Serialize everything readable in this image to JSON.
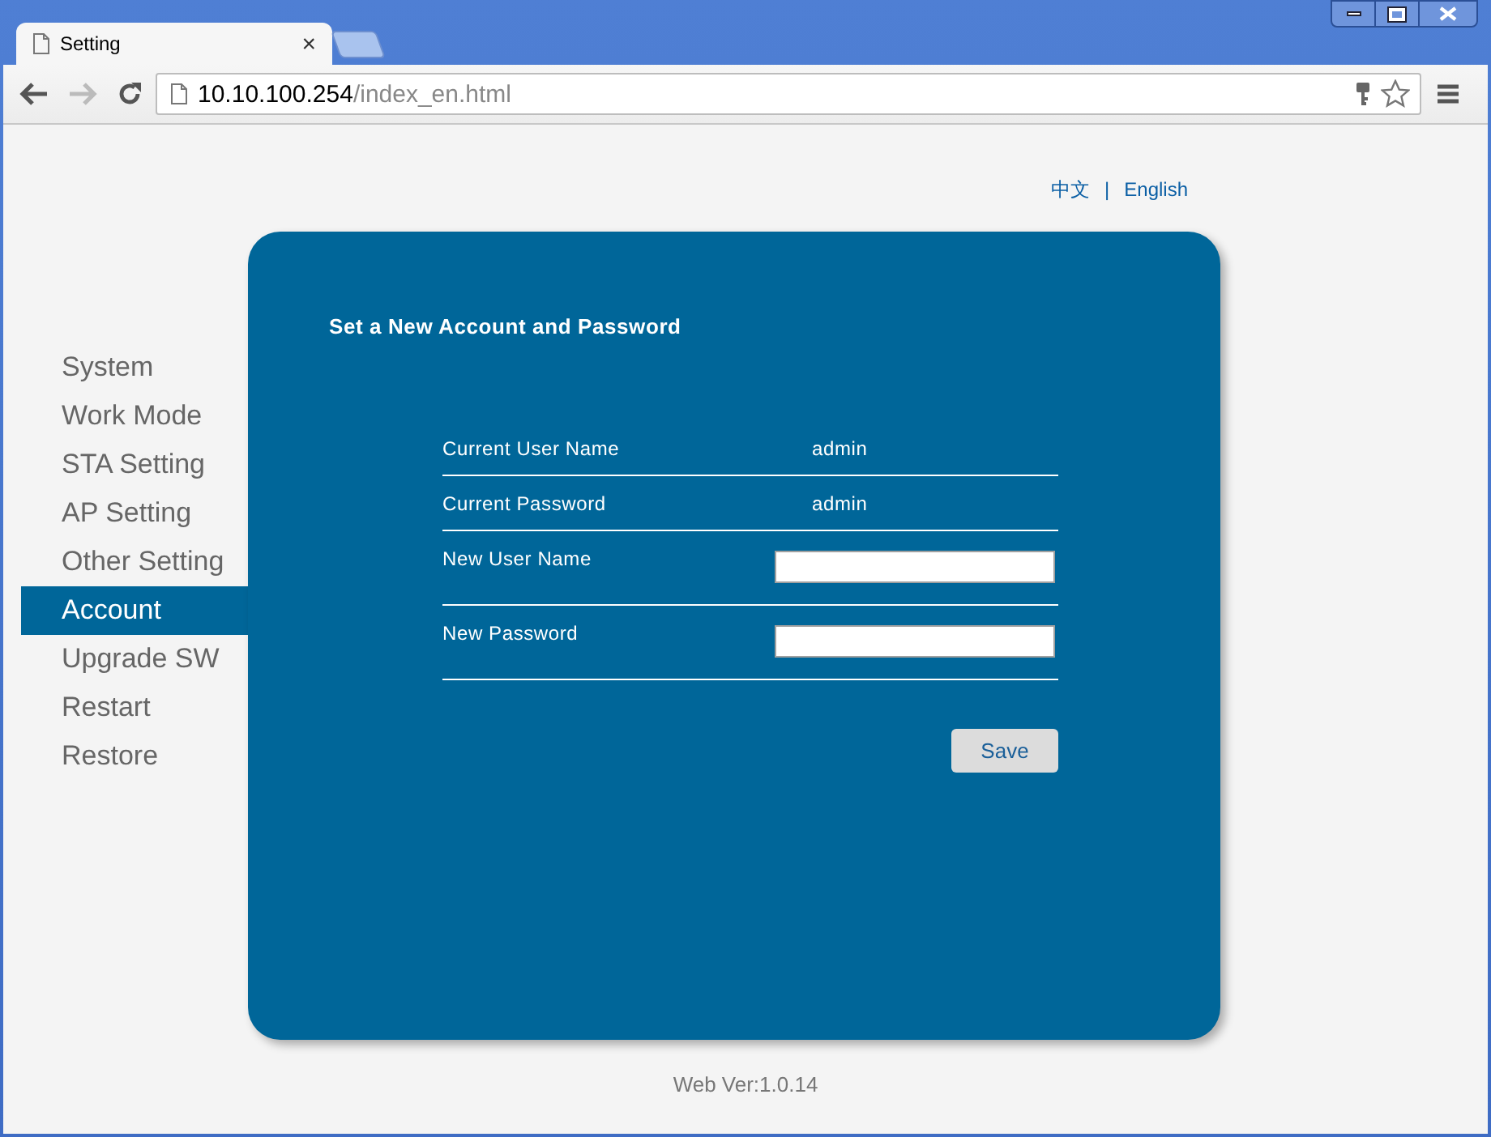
{
  "browser": {
    "tabs": [
      {
        "title": "Setting",
        "close": "×",
        "selected": true
      },
      {
        "selected": false
      }
    ],
    "address": {
      "host": "10.10.100.254",
      "path": "/index_en.html"
    }
  },
  "languages": [
    {
      "label": "中文"
    },
    {
      "label": "English"
    }
  ],
  "language_separator": "|",
  "sidebar": {
    "items": [
      {
        "label": "System",
        "selected": false
      },
      {
        "label": "Work Mode",
        "selected": false
      },
      {
        "label": "STA Setting",
        "selected": false
      },
      {
        "label": "AP Setting",
        "selected": false
      },
      {
        "label": "Other Setting",
        "selected": false
      },
      {
        "label": "Account",
        "selected": true
      },
      {
        "label": "Upgrade SW",
        "selected": false
      },
      {
        "label": "Restart",
        "selected": false
      },
      {
        "label": "Restore",
        "selected": false
      }
    ]
  },
  "panel": {
    "title": "Set a New Account and Password",
    "rows": [
      {
        "kind": "text",
        "label": "Current User Name",
        "value": "admin"
      },
      {
        "kind": "text",
        "label": "Current Password",
        "value": "admin"
      },
      {
        "kind": "input",
        "label": "New User Name"
      },
      {
        "kind": "input",
        "label": "New Password"
      }
    ],
    "save_button": "Save"
  },
  "footer": "Web Ver:1.0.14"
}
